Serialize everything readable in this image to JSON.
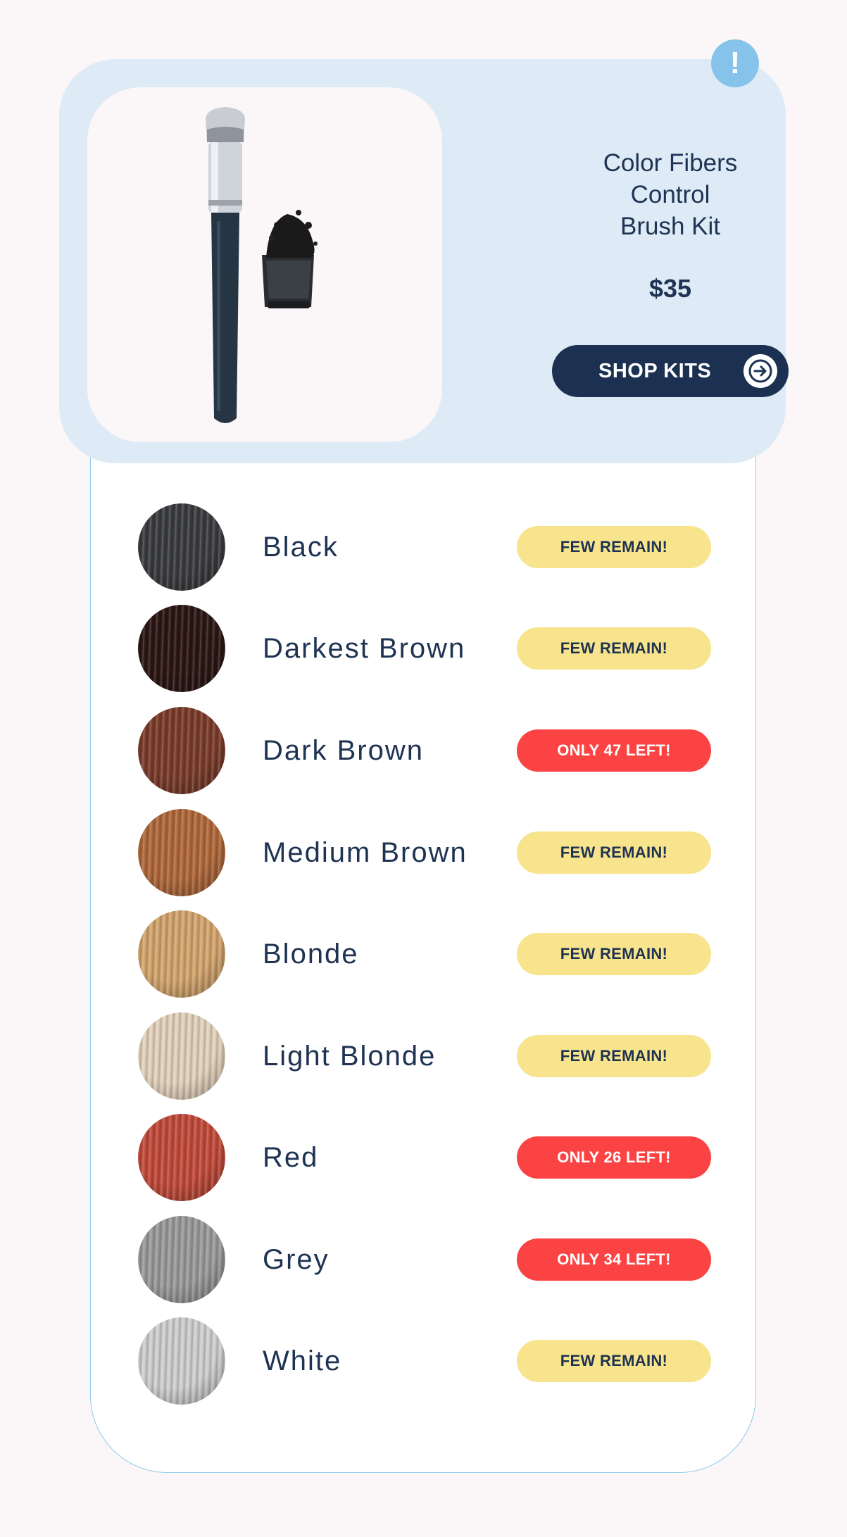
{
  "product": {
    "title_lines": [
      "Color Fibers",
      "Control",
      "Brush Kit"
    ],
    "price": "$35",
    "shop_button_label": "SHOP KITS",
    "alert_icon": "exclamation-icon",
    "accent_colors": {
      "card_bg": "#deeaf5",
      "button_bg": "#1c3152",
      "alert_badge": "#86c3ea"
    }
  },
  "shades": [
    {
      "name": "Black",
      "badge": "FEW REMAIN!",
      "badge_type": "few",
      "color": "#3a3b3e"
    },
    {
      "name": "Darkest Brown",
      "badge": "FEW REMAIN!",
      "badge_type": "few",
      "color": "#2a1512"
    },
    {
      "name": "Dark Brown",
      "badge": "ONLY 47 LEFT!",
      "badge_type": "only",
      "color": "#7a3b2a"
    },
    {
      "name": "Medium Brown",
      "badge": "FEW REMAIN!",
      "badge_type": "few",
      "color": "#b0683a"
    },
    {
      "name": "Blonde",
      "badge": "FEW REMAIN!",
      "badge_type": "few",
      "color": "#d4a56d"
    },
    {
      "name": "Light Blonde",
      "badge": "FEW REMAIN!",
      "badge_type": "few",
      "color": "#e3d2bc"
    },
    {
      "name": "Red",
      "badge": "ONLY 26 LEFT!",
      "badge_type": "only",
      "color": "#c24a3a"
    },
    {
      "name": "Grey",
      "badge": "ONLY 34 LEFT!",
      "badge_type": "only",
      "color": "#9a9a9a"
    },
    {
      "name": "White",
      "badge": "FEW REMAIN!",
      "badge_type": "few",
      "color": "#cfcfcf"
    }
  ],
  "badge_colors": {
    "few": "#f8e48d",
    "only": "#fc4343"
  }
}
